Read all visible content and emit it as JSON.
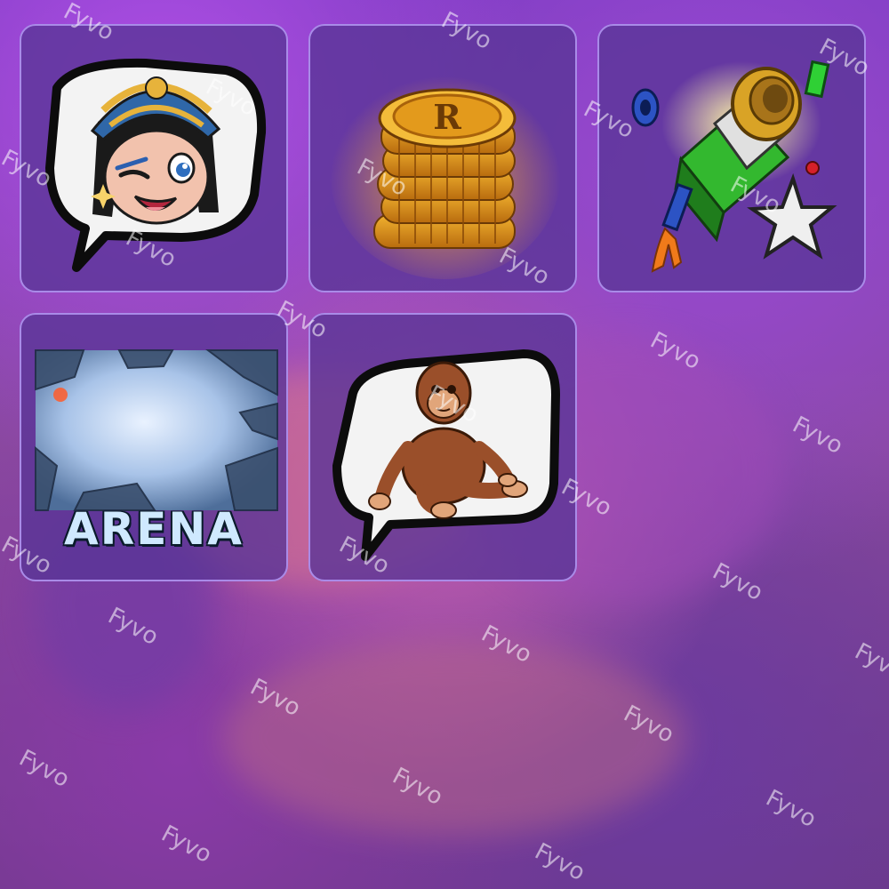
{
  "watermark_text": "Fyvo",
  "tiles": [
    {
      "name": "emote-pharaoh-wink",
      "icon": "pharaoh-emote-icon"
    },
    {
      "name": "coin-stack",
      "icon": "coin-stack-icon",
      "coin_letter": "R"
    },
    {
      "name": "rocket-cannon",
      "icon": "rocket-cannon-icon"
    },
    {
      "name": "arena",
      "icon": "arena-icon",
      "label": "ARENA"
    },
    {
      "name": "emote-monkey",
      "icon": "monkey-emote-icon"
    }
  ],
  "colors": {
    "tile_border": "#a98be8",
    "tile_fill": "#5a3496",
    "coin_gold": "#f0a91e",
    "arena_text": "#cfe9ff"
  }
}
